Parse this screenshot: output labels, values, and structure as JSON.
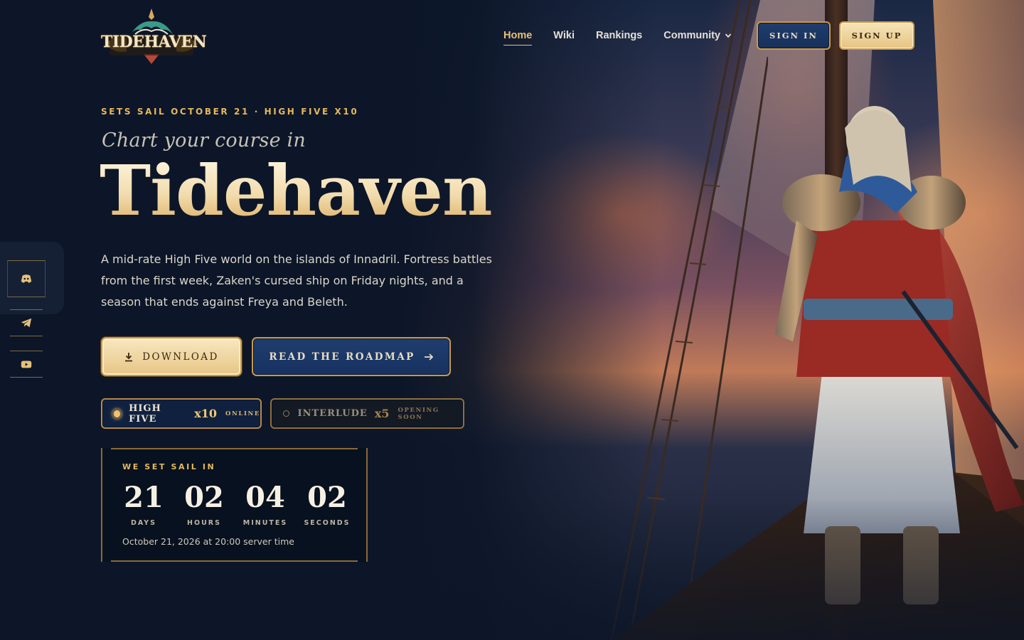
{
  "brand": {
    "logo_text": "TIDEHAVEN"
  },
  "nav": {
    "items": [
      {
        "label": "Home",
        "active": true
      },
      {
        "label": "Wiki",
        "active": false
      },
      {
        "label": "Rankings",
        "active": false
      },
      {
        "label": "Community",
        "active": false,
        "has_dropdown": true
      }
    ],
    "sign_in": "SIGN IN",
    "sign_up": "SIGN UP"
  },
  "social": [
    {
      "icon": "discord-icon"
    },
    {
      "icon": "telegram-icon"
    },
    {
      "icon": "youtube-icon"
    }
  ],
  "hero": {
    "kicker": "SETS SAIL OCTOBER 21 · HIGH FIVE X10",
    "tagline": "Chart your course in",
    "title": "Tidehaven",
    "lede": "A mid-rate High Five world on the islands of Innadril. Fortress battles from the first week, Zaken's cursed ship on Friday nights, and a season that ends against Freya and Beleth.",
    "cta_download": "DOWNLOAD",
    "cta_roadmap": "READ THE ROADMAP"
  },
  "servers": [
    {
      "name": "HIGH FIVE",
      "rate": "x10",
      "status": "ONLINE"
    },
    {
      "name": "INTERLUDE",
      "rate": "x5",
      "status": "OPENING SOON"
    }
  ],
  "countdown": {
    "heading": "WE SET SAIL IN",
    "units": [
      {
        "value": "21",
        "label": "DAYS"
      },
      {
        "value": "02",
        "label": "HOURS"
      },
      {
        "value": "04",
        "label": "MINUTES"
      },
      {
        "value": "02",
        "label": "SECONDS"
      }
    ],
    "note": "October 21, 2026 at 20:00 server time"
  },
  "colors": {
    "background": "#0c1628",
    "accent_gold": "#e6b85c",
    "button_navy": "#1f3d6e",
    "button_gold": "#e7c585"
  }
}
